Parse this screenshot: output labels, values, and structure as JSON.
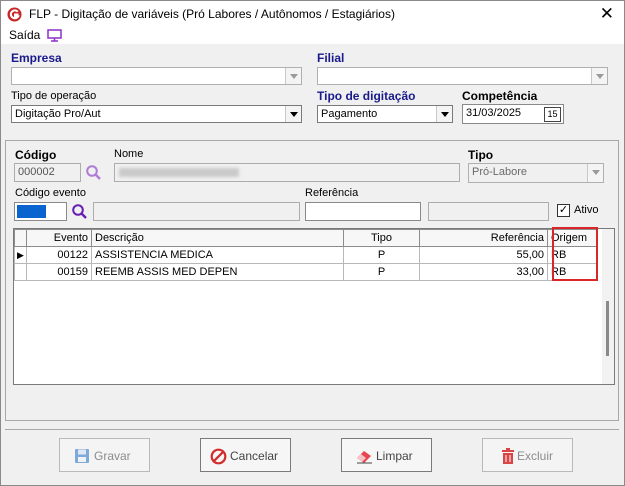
{
  "window": {
    "title": "FLP - Digitação de variáveis (Pró Labores / Autônomos / Estagiários)",
    "close": "✕"
  },
  "menu": {
    "saida": "Saída"
  },
  "header": {
    "empresa_label": "Empresa",
    "empresa_value": "",
    "filial_label": "Filial",
    "filial_value": "",
    "tipo_operacao_label": "Tipo de operação",
    "tipo_operacao_value": "Digitação Pro/Aut",
    "tipo_digitacao_label": "Tipo de digitação",
    "tipo_digitacao_value": "Pagamento",
    "competencia_label": "Competência",
    "competencia_value": "31/03/2025",
    "calendar_day": "15"
  },
  "person": {
    "codigo_label": "Código",
    "codigo_value": "000002",
    "nome_label": "Nome",
    "nome_value": "",
    "tipo_label": "Tipo",
    "tipo_value": "Pró-Labore",
    "codigo_evento_label": "Código evento",
    "referencia_label": "Referência",
    "ativo_label": "Ativo",
    "ativo_checked": true
  },
  "grid": {
    "columns": [
      "Evento",
      "Descrição",
      "Tipo",
      "Referência",
      "Origem"
    ],
    "rows": [
      {
        "evento": "00122",
        "descricao": "ASSISTENCIA MEDICA",
        "tipo": "P",
        "referencia": "55,00",
        "origem": "RB"
      },
      {
        "evento": "00159",
        "descricao": "REEMB ASSIS MED DEPEN",
        "tipo": "P",
        "referencia": "33,00",
        "origem": "RB"
      }
    ]
  },
  "buttons": {
    "gravar": "Gravar",
    "cancelar": "Cancelar",
    "limpar": "Limpar",
    "excluir": "Excluir"
  },
  "colors": {
    "accent": "#1a1a8c",
    "highlight": "#d9262b",
    "logo": "#c62828"
  }
}
